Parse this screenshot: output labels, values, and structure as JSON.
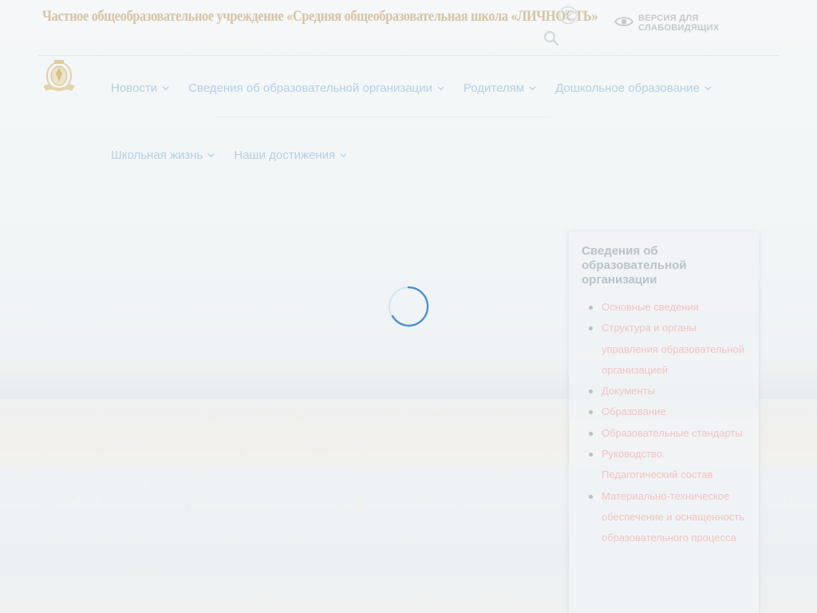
{
  "header": {
    "school_title": "Частное общеобразовательное учреждение «Средняя общеобразовательная школа «ЛИЧНОСТЬ»",
    "accessibility_label": "ВЕРСИЯ ДЛЯ СЛАБОВИДЯЩИХ",
    "icons": [
      "user-icon",
      "search-icon",
      "eye-icon",
      "school-emblem-logo"
    ]
  },
  "nav": {
    "row1": [
      {
        "label": "Новости"
      },
      {
        "label": "Сведения об образовательной организации"
      },
      {
        "label": "Родителям"
      },
      {
        "label": "Дошкольное образование"
      }
    ],
    "row2": [
      {
        "label": "Школьная жизнь"
      },
      {
        "label": "Наши достижения"
      }
    ]
  },
  "sidebar": {
    "title": "Сведения об образовательной организации",
    "items": [
      "Основные сведения",
      "Структура и органы управления образовательной организацией",
      "Документы",
      "Образование",
      "Образовательные стандарты",
      "Руководство.",
      "Педагогический состав",
      "Материально-техническое обеспечение и оснащенность образовательного процесса"
    ]
  },
  "colors": {
    "nav_link": "#b5cfe4",
    "sidebar_link": "#f1c3c3",
    "title_gold": "#d5c4a5",
    "spinner": "#4f8fd6"
  }
}
